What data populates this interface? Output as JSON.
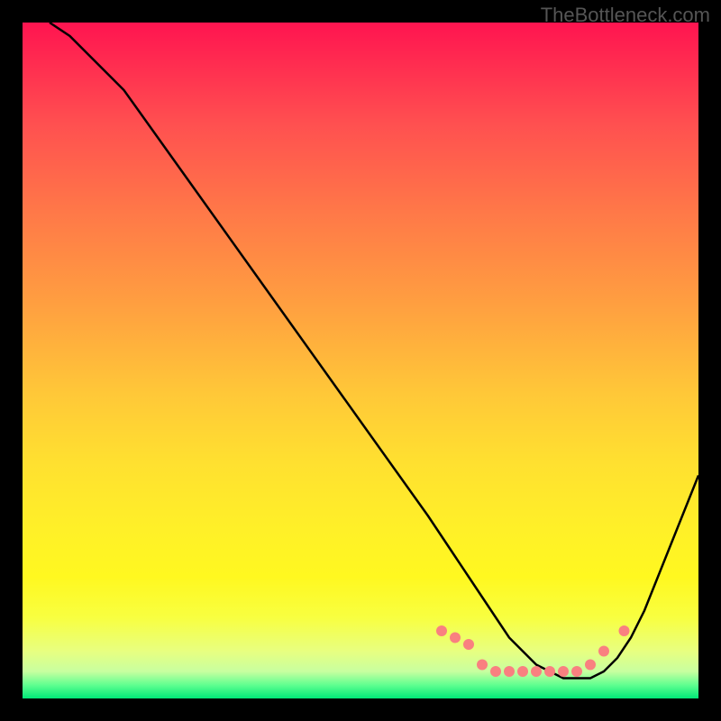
{
  "watermark": "TheBottleneck.com",
  "chart_data": {
    "type": "line",
    "title": "",
    "xlabel": "",
    "ylabel": "",
    "xlim": [
      0,
      100
    ],
    "ylim": [
      0,
      100
    ],
    "series": [
      {
        "name": "curve",
        "color": "#000000",
        "x": [
          4,
          7,
          10,
          15,
          20,
          25,
          30,
          35,
          40,
          45,
          50,
          55,
          60,
          62,
          64,
          66,
          68,
          70,
          72,
          74,
          76,
          78,
          80,
          82,
          84,
          86,
          88,
          90,
          92,
          94,
          96,
          100
        ],
        "y": [
          100,
          98,
          95,
          90,
          83,
          76,
          69,
          62,
          55,
          48,
          41,
          34,
          27,
          24,
          21,
          18,
          15,
          12,
          9,
          7,
          5,
          4,
          3,
          3,
          3,
          4,
          6,
          9,
          13,
          18,
          23,
          33
        ]
      }
    ],
    "markers": [
      {
        "x": 62,
        "y": 10,
        "color": "#f98080"
      },
      {
        "x": 64,
        "y": 9,
        "color": "#f98080"
      },
      {
        "x": 66,
        "y": 8,
        "color": "#f98080"
      },
      {
        "x": 68,
        "y": 5,
        "color": "#f98080"
      },
      {
        "x": 70,
        "y": 4,
        "color": "#f98080"
      },
      {
        "x": 72,
        "y": 4,
        "color": "#f98080"
      },
      {
        "x": 74,
        "y": 4,
        "color": "#f98080"
      },
      {
        "x": 76,
        "y": 4,
        "color": "#f98080"
      },
      {
        "x": 78,
        "y": 4,
        "color": "#f98080"
      },
      {
        "x": 80,
        "y": 4,
        "color": "#f98080"
      },
      {
        "x": 82,
        "y": 4,
        "color": "#f98080"
      },
      {
        "x": 84,
        "y": 5,
        "color": "#f98080"
      },
      {
        "x": 86,
        "y": 7,
        "color": "#f98080"
      },
      {
        "x": 89,
        "y": 10,
        "color": "#f98080"
      }
    ],
    "gradient_stops": [
      {
        "pos": 0,
        "color": "#ff1450"
      },
      {
        "pos": 50,
        "color": "#ffc838"
      },
      {
        "pos": 85,
        "color": "#fff820"
      },
      {
        "pos": 100,
        "color": "#00e878"
      }
    ]
  }
}
